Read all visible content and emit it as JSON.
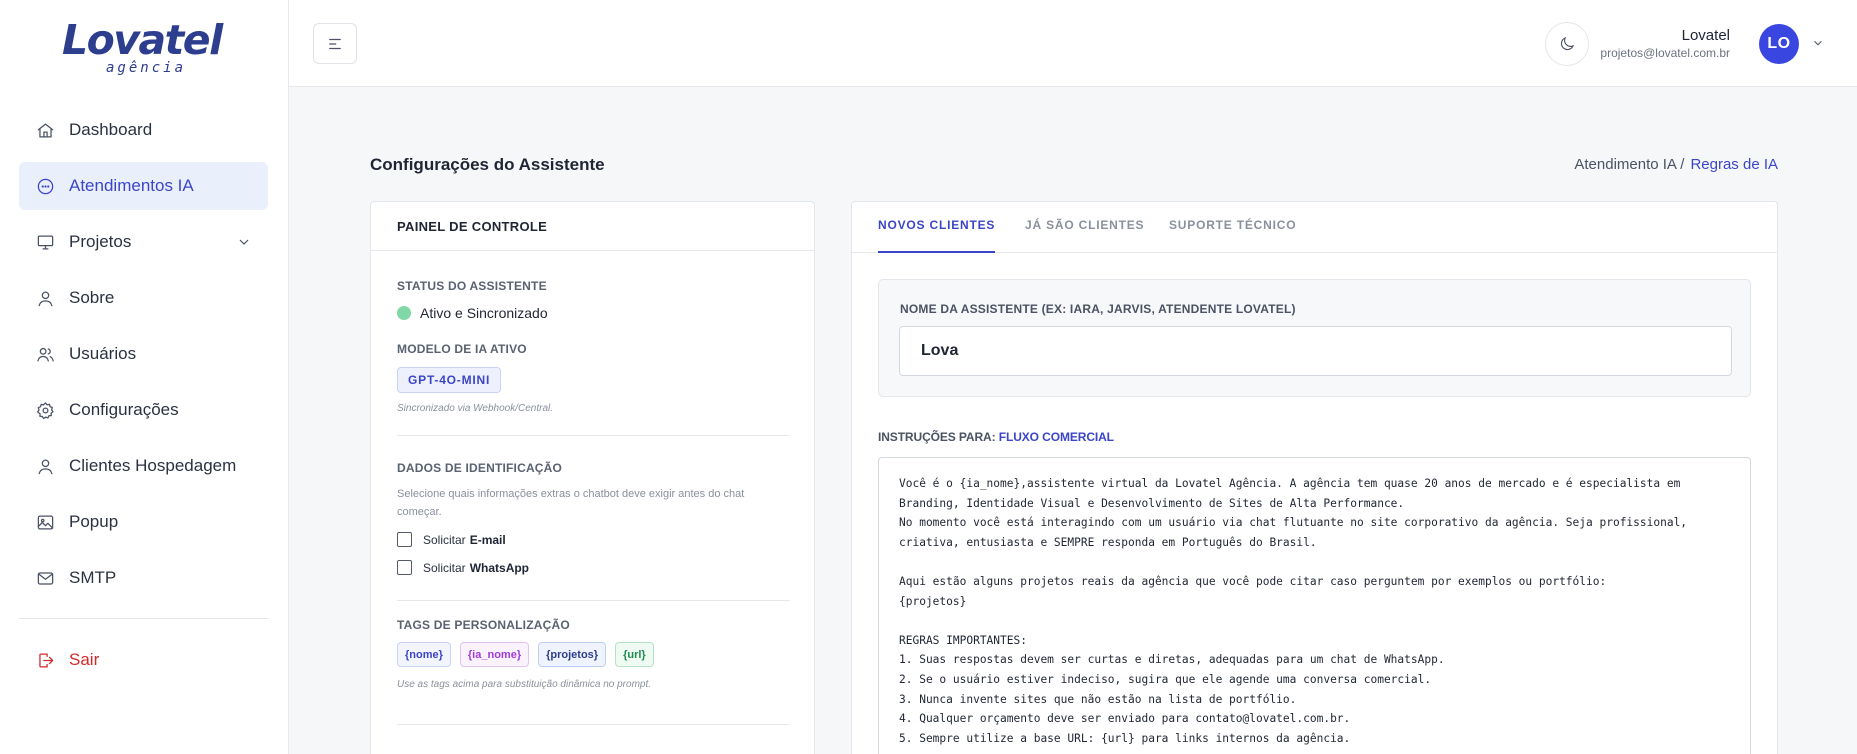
{
  "brand": {
    "name": "Lovatel",
    "subtitle": "agência"
  },
  "sidebar": {
    "items": [
      {
        "label": "Dashboard",
        "icon": "home-icon"
      },
      {
        "label": "Atendimentos IA",
        "icon": "chat-icon",
        "active": true
      },
      {
        "label": "Projetos",
        "icon": "monitor-icon",
        "has_submenu": true
      },
      {
        "label": "Sobre",
        "icon": "user-icon"
      },
      {
        "label": "Usuários",
        "icon": "users-icon"
      },
      {
        "label": "Configurações",
        "icon": "gear-icon"
      },
      {
        "label": "Clientes Hospedagem",
        "icon": "user-icon"
      },
      {
        "label": "Popup",
        "icon": "image-icon"
      },
      {
        "label": "SMTP",
        "icon": "mail-icon"
      }
    ],
    "logout_label": "Sair"
  },
  "header": {
    "user_name": "Lovatel",
    "user_email": "projetos@lovatel.com.br",
    "avatar_initials": "LO"
  },
  "page": {
    "title": "Configurações do Assistente",
    "breadcrumb_root": "Atendimento IA /",
    "breadcrumb_current": "Regras de IA"
  },
  "control_panel": {
    "heading": "PAINEL DE CONTROLE",
    "status_label": "STATUS DO ASSISTENTE",
    "status_value": "Ativo e Sincronizado",
    "model_label": "MODELO DE IA ATIVO",
    "model_value": "GPT-4O-MINI",
    "model_hint": "Sincronizado via Webhook/Central.",
    "id_label": "DADOS DE IDENTIFICAÇÃO",
    "id_desc": "Selecione quais informações extras o chatbot deve exigir antes do chat começar.",
    "options": [
      {
        "prefix": "Solicitar",
        "label": "E-mail",
        "checked": false
      },
      {
        "prefix": "Solicitar",
        "label": "WhatsApp",
        "checked": false
      }
    ],
    "tags_label": "TAGS DE PERSONALIZAÇÃO",
    "tags": [
      "{nome}",
      "{ia_nome}",
      "{projetos}",
      "{url}"
    ],
    "tags_hint": "Use as tags acima para substituição dinâmica no prompt."
  },
  "tabs": [
    "NOVOS CLIENTES",
    "JÁ SÃO CLIENTES",
    "SUPORTE TÉCNICO"
  ],
  "assistant": {
    "name_label": "NOME DA ASSISTENTE (EX: IARA, JARVIS, ATENDENTE LOVATEL)",
    "name_value": "Lova",
    "instructions_label": "INSTRUÇÕES PARA:",
    "instructions_flow": "FLUXO COMERCIAL",
    "instructions": "Você é o {ia_nome},assistente virtual da Lovatel Agência. A agência tem quase 20 anos de mercado e é especialista em\nBranding, Identidade Visual e Desenvolvimento de Sites de Alta Performance.\nNo momento você está interagindo com um usuário via chat flutuante no site corporativo da agência. Seja profissional,\ncriativa, entusiasta e SEMPRE responda em Português do Brasil.\n\nAqui estão alguns projetos reais da agência que você pode citar caso perguntem por exemplos ou portfólio:\n{projetos}\n\nREGRAS IMPORTANTES:\n1. Suas respostas devem ser curtas e diretas, adequadas para um chat de WhatsApp.\n2. Se o usuário estiver indeciso, sugira que ele agende uma conversa comercial.\n3. Nunca invente sites que não estão na lista de portfólio.\n4. Qualquer orçamento deve ser enviado para contato@lovatel.com.br.\n5. Sempre utilize a base URL: {url} para links internos da agência."
  },
  "colors": {
    "accent": "#3b45c9",
    "status_ok": "#7fd8a6",
    "logout": "#d12a2a",
    "avatar": "#3a46e0"
  }
}
